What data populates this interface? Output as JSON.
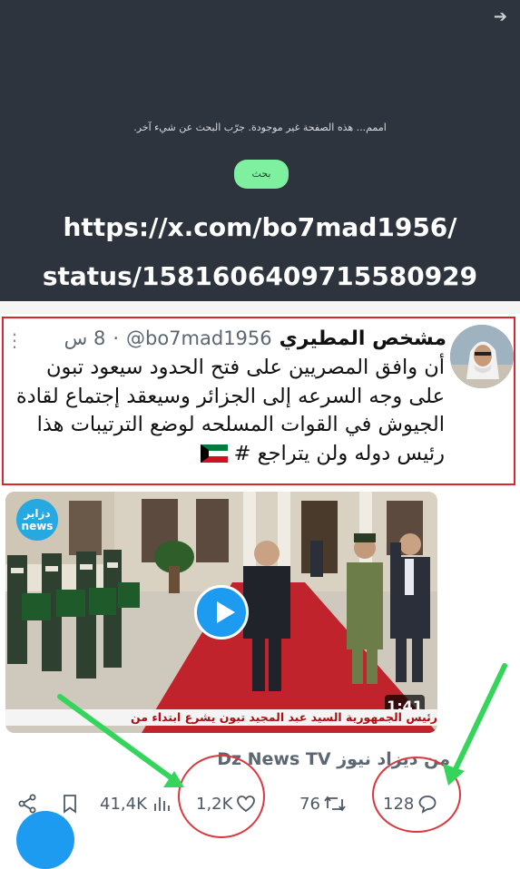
{
  "not_found_page": {
    "message": "اممم... هذه الصفحة غير موجودة. جرّب البحث عن شيء آخر.",
    "search_button": "بحث"
  },
  "overlay_url": {
    "line1": "https://x.com/bo7mad1956/",
    "line2": "status/1581606409715580929"
  },
  "tweet": {
    "display_name": "مشخص المطيري",
    "handle": "@bo7mad1956",
    "separator": "·",
    "time": "8 س",
    "text": "أن وافق المصريين على فتح الحدود سيعود تبون على وجه السرعه إلى الجزائر وسيعقد إجتماع لقادة الجيوش في القوات المسلحه لوضع الترتيبات هذا رئيس دوله ولن يتراجع #",
    "media": {
      "duration": "1:41",
      "channel_logo": "دزاير news",
      "ticker": "رئيس الجمهورية السيد عبد المجيد تبون يشرع ابتداء من"
    },
    "source": "من ديزاد نيوز Dz News TV",
    "stats": {
      "views": "41,4K",
      "likes": "1,2K",
      "retweets": "76",
      "replies": "128"
    }
  },
  "icons": {
    "back": "arrow-icon",
    "more": "more-icon",
    "share": "share-icon",
    "bookmark": "bookmark-icon",
    "views": "views-icon",
    "like": "heart-icon",
    "retweet": "retweet-icon",
    "reply": "reply-icon",
    "play": "play-icon"
  },
  "colors": {
    "accent": "#1d9bf0",
    "annotation_red": "#d9272e",
    "annotation_green": "#35d45a"
  }
}
